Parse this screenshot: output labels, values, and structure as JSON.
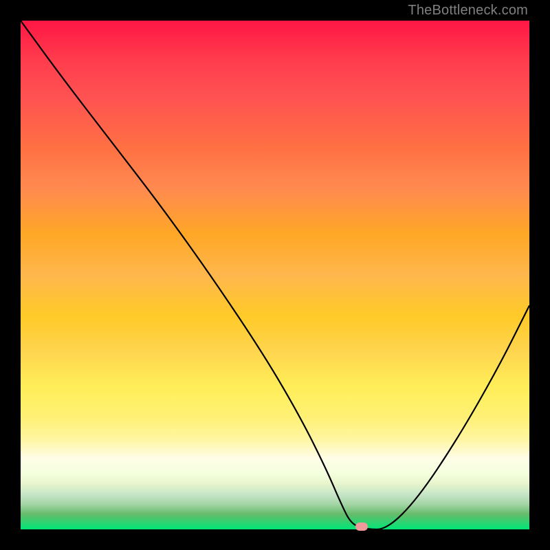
{
  "watermark": "TheBottleneck.com",
  "chart_data": {
    "type": "line",
    "title": "",
    "xlabel": "",
    "ylabel": "",
    "xlim": [
      0,
      100
    ],
    "ylim": [
      0,
      100
    ],
    "grid": false,
    "series": [
      {
        "name": "bottleneck-curve",
        "x": [
          0,
          8,
          18,
          28,
          38,
          48,
          55,
          60,
          63,
          65,
          68,
          72,
          78,
          86,
          94,
          100
        ],
        "y": [
          100,
          89,
          76,
          63,
          49,
          34,
          22,
          12,
          5,
          1,
          0,
          0,
          6,
          18,
          32,
          44
        ]
      }
    ],
    "marker": {
      "x": 67,
      "y": 0.5
    },
    "gradient_bands": [
      {
        "y": 100,
        "color": "#ff1744"
      },
      {
        "y": 50,
        "color": "#ffca28"
      },
      {
        "y": 15,
        "color": "#fffde7"
      },
      {
        "y": 0,
        "color": "#00e676"
      }
    ]
  }
}
